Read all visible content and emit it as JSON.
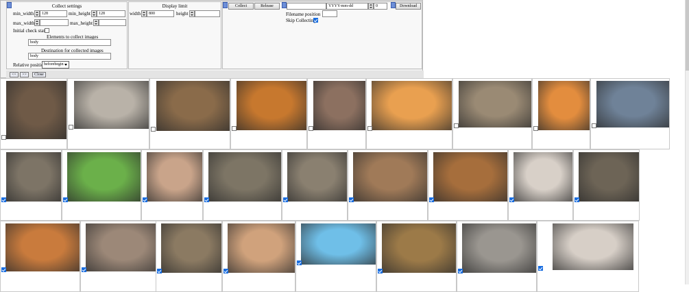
{
  "collect_settings": {
    "title": "Collect settings",
    "min_width_label": "min_width",
    "min_width_value": "128",
    "min_height_label": "min_height",
    "min_height_value": "128",
    "max_width_label": "max_width",
    "max_width_value": "",
    "max_height_label": "max_height",
    "max_height_value": "",
    "initial_check_state_label": "Initial check state",
    "elements_label": "Elements to collect images",
    "elements_value": "body",
    "destination_label": "Destination for collected images",
    "destination_value": "body",
    "relative_position_label": "Relative position",
    "relative_position_value": "beforebegin"
  },
  "display_limit": {
    "title": "Display limit",
    "width_label": "width",
    "width_value": "800",
    "height_label": "height",
    "height_value": ""
  },
  "actions": {
    "collect_label": "Collect",
    "release_label": "Release",
    "prefix_value": "",
    "date_format_value": "YYYY-mm-dd",
    "number_value": "0",
    "download_label": "Download",
    "filename_position_label": "Filename position",
    "filename_position_value": "",
    "skip_collecting_label": "Skip Collecting"
  },
  "nav": {
    "prev_label": "<<",
    "next_label": ">>",
    "close_label": "Close"
  },
  "images": [
    {
      "name": "cat-image-1",
      "color": "#6f5a47",
      "checked": false
    },
    {
      "name": "cat-image-2",
      "color": "#b9b2a8",
      "checked": false
    },
    {
      "name": "cat-image-3",
      "color": "#8a6b4a",
      "checked": false
    },
    {
      "name": "cat-image-4",
      "color": "#c7782e",
      "checked": false
    },
    {
      "name": "cat-image-5",
      "color": "#8c7060",
      "checked": false
    },
    {
      "name": "cat-image-6",
      "color": "#e9a050",
      "checked": false
    },
    {
      "name": "cat-image-7",
      "color": "#9a8a74",
      "checked": false
    },
    {
      "name": "cat-image-8",
      "color": "#e38d3e",
      "checked": false
    },
    {
      "name": "cat-image-9",
      "color": "#6f8298",
      "checked": false
    },
    {
      "name": "cat-image-10",
      "color": "#7d7466",
      "checked": true
    },
    {
      "name": "cat-image-11",
      "color": "#6bb04a",
      "checked": true
    },
    {
      "name": "cat-image-12",
      "color": "#c9a48a",
      "checked": true
    },
    {
      "name": "cat-image-13",
      "color": "#7d7565",
      "checked": true
    },
    {
      "name": "cat-image-14",
      "color": "#8a8070",
      "checked": true
    },
    {
      "name": "cat-image-15",
      "color": "#a07a58",
      "checked": true
    },
    {
      "name": "cat-image-16",
      "color": "#a66e3c",
      "checked": true
    },
    {
      "name": "cat-image-17",
      "color": "#d8d0c8",
      "checked": true
    },
    {
      "name": "cat-image-18",
      "color": "#6d6456",
      "checked": true
    },
    {
      "name": "cat-image-19",
      "color": "#c97b3d",
      "checked": true
    },
    {
      "name": "cat-image-20",
      "color": "#9c8878",
      "checked": true
    },
    {
      "name": "cat-image-21",
      "color": "#8b7a62",
      "checked": true
    },
    {
      "name": "cat-image-22",
      "color": "#d0a27c",
      "checked": true
    },
    {
      "name": "cat-image-23",
      "color": "#6fbfe8",
      "checked": true
    },
    {
      "name": "cat-image-24",
      "color": "#9c7a48",
      "checked": true
    },
    {
      "name": "cat-image-25",
      "color": "#9a9690",
      "checked": true
    },
    {
      "name": "cat-image-26",
      "color": "#d7cfc7",
      "checked": true
    }
  ]
}
